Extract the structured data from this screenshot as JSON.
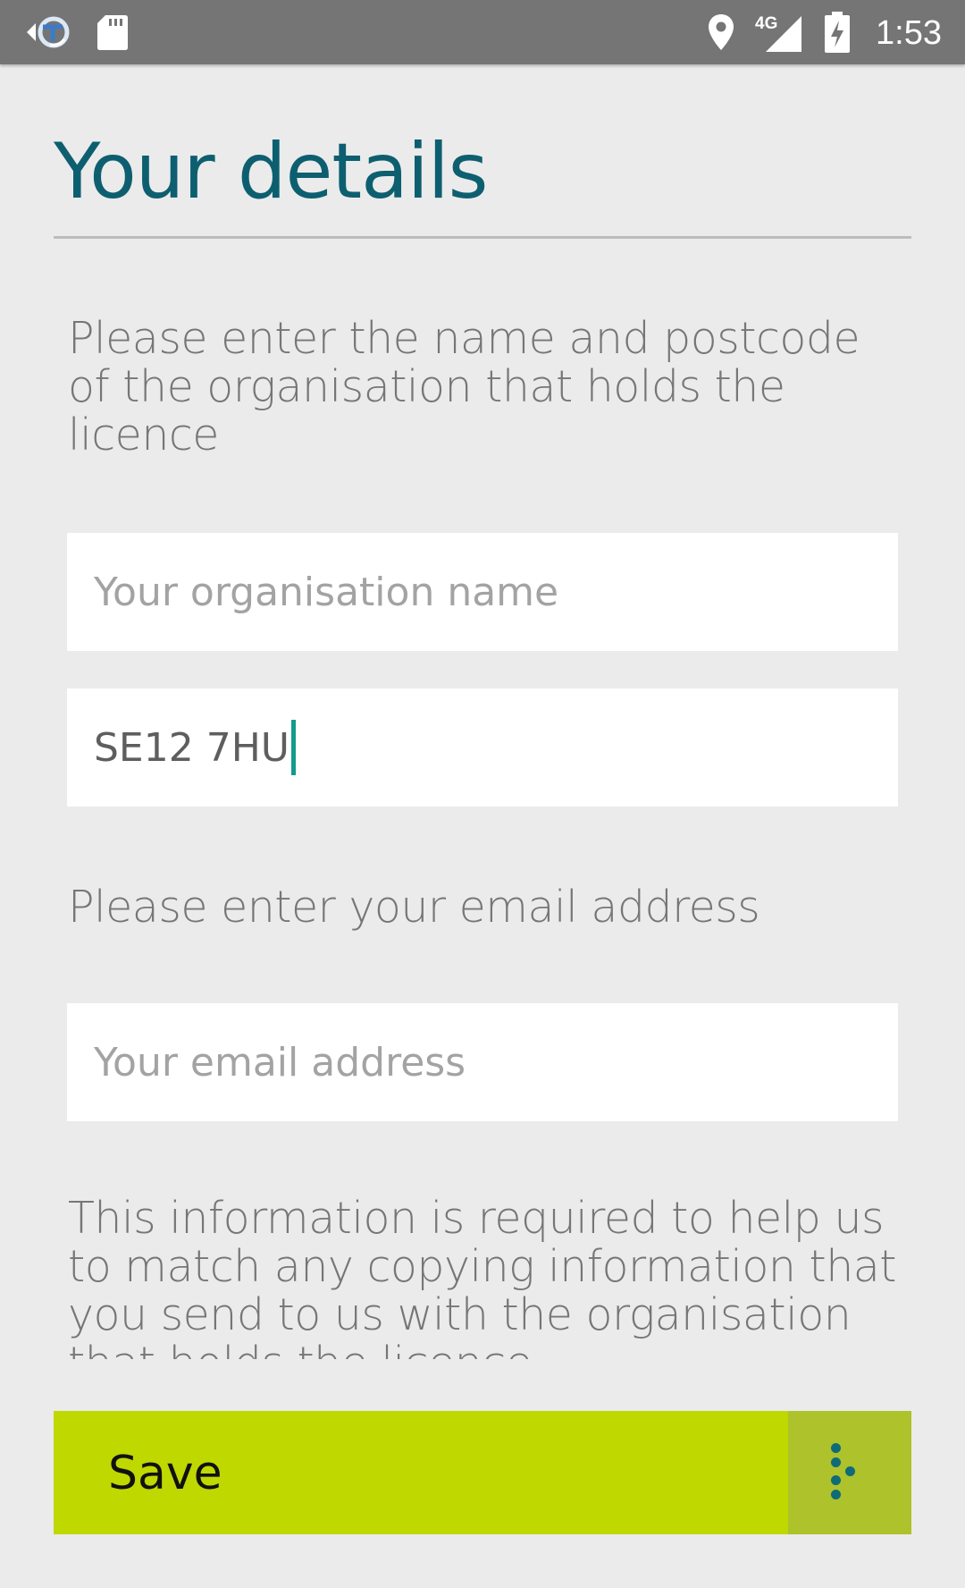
{
  "status_bar": {
    "time": "1:53",
    "network": "4G",
    "icons": [
      "app-notification-icon",
      "sd-card-icon",
      "location-icon",
      "signal-icon",
      "battery-charging-icon"
    ]
  },
  "page": {
    "title": "Your details"
  },
  "organisation_section": {
    "instruction": "Please enter the name and postcode of the organisation that holds the licence",
    "name_placeholder": "Your organisation name",
    "postcode_value": "SE12 7HU"
  },
  "email_section": {
    "instruction": "Please enter your email address",
    "email_placeholder": "Your email address"
  },
  "info": {
    "text": "This information is required to help us to match any copying information that you send to us with the organisation that holds the licence"
  },
  "save_bar": {
    "label": "Save",
    "arrow_icon": "dotted-chevron-right-icon"
  },
  "colors": {
    "accent_title": "#0d5f70",
    "save_bar": "#bfd800",
    "save_arrow_bg": "#adc22b",
    "caret": "#129a8c"
  }
}
